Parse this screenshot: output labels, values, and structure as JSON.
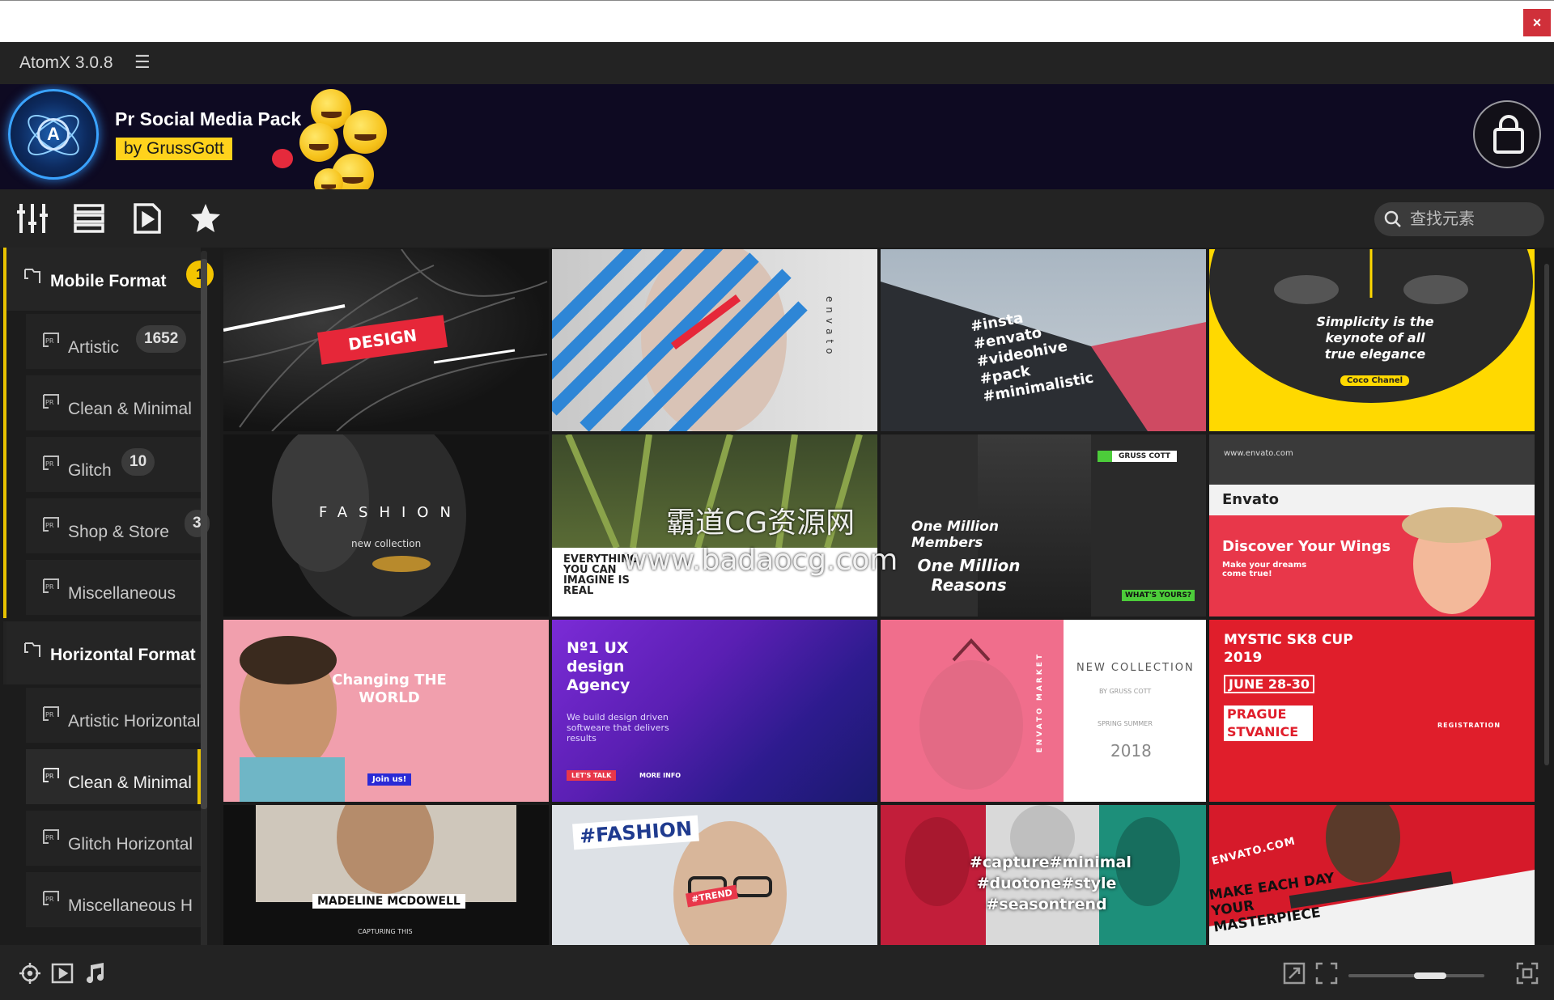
{
  "app": {
    "title": "AtomX 3.0.8",
    "menu_icon": "hamburger-menu-icon"
  },
  "os": {
    "close_label": "×"
  },
  "banner": {
    "pack_title": "Pr Social Media Pack",
    "by_label": "by GrussGott"
  },
  "search": {
    "placeholder": "查找元素"
  },
  "sidebar": {
    "groups": [
      {
        "label": "Mobile Format",
        "count": "1",
        "items": [
          {
            "label": "Artistic",
            "count": "1652"
          },
          {
            "label": "Clean & Minimal",
            "count": ""
          },
          {
            "label": "Glitch",
            "count": "10"
          },
          {
            "label": "Shop & Store",
            "count": "3"
          },
          {
            "label": "Miscellaneous",
            "count": ""
          }
        ]
      },
      {
        "label": "Horizontal Format",
        "count": "",
        "items": [
          {
            "label": "Artistic Horizontal",
            "count": ""
          },
          {
            "label": "Clean & Minimal",
            "count": "",
            "selected": true
          },
          {
            "label": "Glitch Horizontal",
            "count": ""
          },
          {
            "label": "Miscellaneous H",
            "count": ""
          }
        ]
      }
    ]
  },
  "thumbnails": [
    {
      "id": 1,
      "text": "DESIGN"
    },
    {
      "id": 2,
      "text": "envato"
    },
    {
      "id": 3,
      "text": "#insta #envato #videohive #pack #minimalistic"
    },
    {
      "id": 4,
      "text": "Simplicity is the keynote of all true elegance",
      "sub": "Coco Chanel"
    },
    {
      "id": 5,
      "text": "FASHION",
      "sub": "new collection"
    },
    {
      "id": 6,
      "text": "EVERYTHING YOU CAN IMAGINE IS REAL"
    },
    {
      "id": 7,
      "text": "One Million Members",
      "sub": "One Million Reasons",
      "badge": "GRUSS COTT",
      "tag": "WHAT'S YOURS?"
    },
    {
      "id": 8,
      "text": "Envato",
      "sub": "Discover Your Wings",
      "small": "Make your dreams come true!",
      "site": "www.envato.com"
    },
    {
      "id": 9,
      "text": "Changing THE WORLD",
      "sub": "Join us!"
    },
    {
      "id": 10,
      "text": "Nº1 UX design Agency",
      "sub": "We build design driven softweare that delivers results",
      "b1": "LET'S TALK",
      "b2": "MORE INFO"
    },
    {
      "id": 11,
      "text": "NEW COLLECTION",
      "sub": "SPRING SUMMER",
      "year": "2018",
      "side": "ENVATO MARKET",
      "author": "BY GRUSS COTT"
    },
    {
      "id": 12,
      "text": "MYSTIC SK8 CUP 2019",
      "sub": "JUNE 28-30",
      "place": "PRAGUE STVANICE",
      "reg": "REGISTRATION"
    },
    {
      "id": 13,
      "text": "MADELINE MCDOWELL",
      "sub": "CAPTURING THIS"
    },
    {
      "id": 14,
      "text": "#FASHION",
      "sub": "#TREND"
    },
    {
      "id": 15,
      "text": "#capture#minimal #duotone#style #seasontrend"
    },
    {
      "id": 16,
      "text": "ENVATO.COM",
      "sub": "MAKE EACH DAY YOUR MASTERPIECE"
    }
  ],
  "watermark": {
    "line1": "霸道CG资源网",
    "line2": "www.badaocg.com"
  },
  "toolbar_icons": [
    "mixer-icon",
    "list-view-icon",
    "play-file-icon",
    "star-icon"
  ],
  "bottom_icons": [
    "target-icon",
    "play-icon",
    "music-icon",
    "fit-icon",
    "fullscreen-icon",
    "expand-icon"
  ],
  "colors": {
    "accent": "#f3c400",
    "bg": "#1b1b1b",
    "panel": "#232323"
  },
  "zoom_slider": {
    "value": 0.6
  }
}
